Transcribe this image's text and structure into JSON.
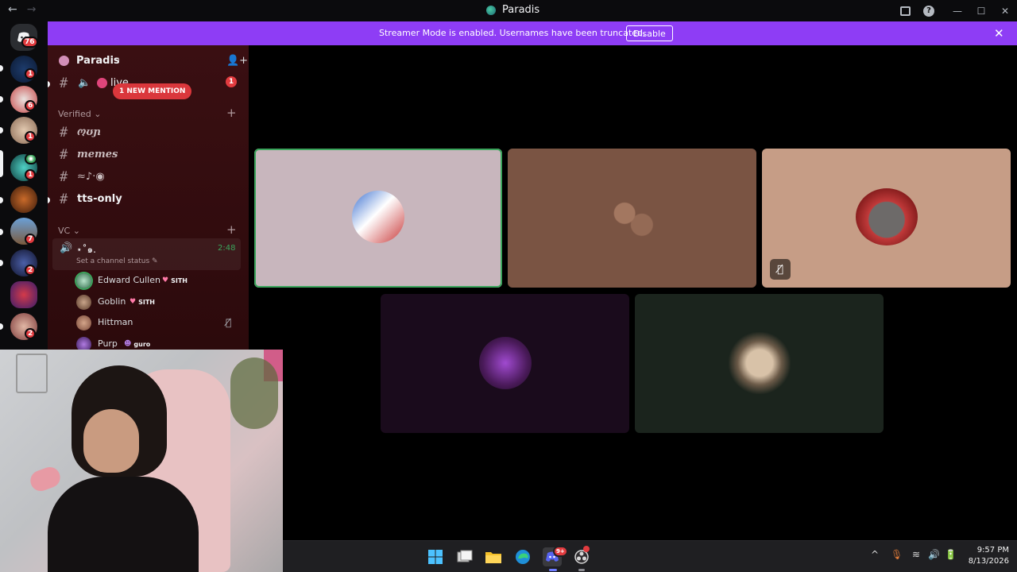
{
  "window": {
    "title": "Paradis",
    "back_glyph": "←",
    "forward_glyph": "→",
    "inbox_icon": "inbox-icon",
    "help_glyph": "?",
    "minimize_glyph": "—",
    "maximize_glyph": "☐",
    "close_glyph": "✕"
  },
  "banner": {
    "text": "Streamer Mode is enabled. Usernames have been truncated.",
    "disable_label": "Disable",
    "close_glyph": "✕",
    "color": "#8e3df5"
  },
  "rail": {
    "home_badge": "76",
    "guild_badges": [
      "1",
      "6",
      "1",
      "1",
      "",
      "7",
      "2",
      "",
      "2"
    ]
  },
  "server": {
    "name": "Paradis",
    "chevron": "⌄",
    "invite_glyph": "👤+"
  },
  "channels": {
    "live": {
      "name": "live",
      "badge": "1",
      "mention_pill": "1 NEW MENTION",
      "speaker_glyph": "🔈"
    },
    "verified_label": "Verified ⌄",
    "verified_add": "+",
    "items": [
      {
        "name": "ოʊɲ"
      },
      {
        "name": "memes"
      },
      {
        "name": "≈♪·◉"
      },
      {
        "name": "tts-only"
      }
    ],
    "vc_label": "VC ⌄",
    "vc_add": "+"
  },
  "voice_channel": {
    "speaker_glyph": "🔊",
    "name": "⋆˚๑.",
    "elapsed": "2:48",
    "status_placeholder": "Set a channel status ✎",
    "members": [
      {
        "name": "Edward Cullen",
        "tag": "SITH",
        "heart": "♥"
      },
      {
        "name": "Goblin",
        "tag": "SITH",
        "heart": "♥"
      },
      {
        "name": "Hittman",
        "muted_icon": "🎙̸"
      },
      {
        "name": "Purp",
        "tag": "guro",
        "heart": "☻"
      }
    ]
  },
  "stage": {
    "tiles_muted_glyph": "🎙̸",
    "tile_colors": [
      "#c8b6bd",
      "#7a5443",
      "#c69d86",
      "#1a0b1c",
      "#1b241d"
    ]
  },
  "taskbar": {
    "discord_badge": "9+",
    "tray_chevron": "^",
    "mic_glyph": "🎙",
    "wifi_glyph": "≋",
    "volume_glyph": "🔊",
    "battery_glyph": "🔋",
    "time": "9:57 PM",
    "date": "8/13/2026"
  }
}
